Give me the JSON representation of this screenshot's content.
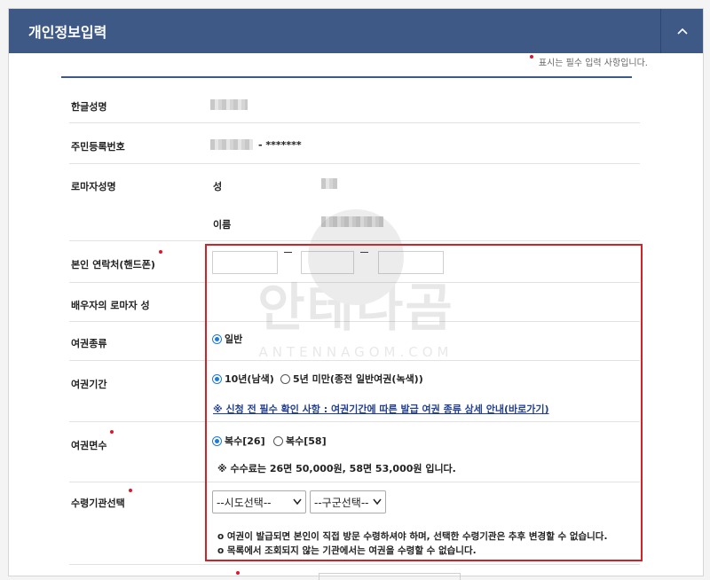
{
  "header": {
    "title": "개인정보입력"
  },
  "required_note": {
    "text": "표시는 필수 입력 사항입니다."
  },
  "rows": {
    "name_kr": {
      "label": "한글성명"
    },
    "resident_no": {
      "label": "주민등록번호",
      "masked": "- *******"
    },
    "roman_name": {
      "label": "로마자성명",
      "surname": "성",
      "given": "이름"
    },
    "phone": {
      "label": "본인 연락처(핸드폰)"
    },
    "spouse": {
      "label": "배우자의 로마자 성"
    },
    "passport_type": {
      "label": "여권종류",
      "options": [
        "일반"
      ]
    },
    "passport_period": {
      "label": "여권기간",
      "options": [
        "10년(남색)",
        "5년 미만(종전 일반여권(녹색))"
      ],
      "link": "※ 신청 전 필수 확인 사항 : 여권기간에 따른 발급 여권 종류 상세 안내(바로가기)"
    },
    "passport_pages": {
      "label": "여권면수",
      "options": [
        "복수[26]",
        "복수[58]"
      ],
      "fee_note": "※ 수수료는 26면 50,000원, 58면 53,000원 입니다."
    },
    "receiving_office": {
      "label": "수령기관선택",
      "select_city": "--시도선택--",
      "select_district": "--구군선택--",
      "notes": [
        "o 여권이 발급되면 본인이 직접 방문 수령하셔야 하며, 선택한 수령기관은 추후 변경할 수 없습니다.",
        "o 목록에서 조회되지 않는 기관에서는 여권을 수령할 수 없습니다."
      ]
    }
  },
  "watermark": {
    "main": "안테나곰",
    "sub": "ANTENNAGOM.COM"
  },
  "colors": {
    "header": "#3e5985",
    "required": "#e0152b",
    "highlight_box": "#d32128",
    "radio": "#1f7bd8",
    "link": "#223f8f"
  }
}
